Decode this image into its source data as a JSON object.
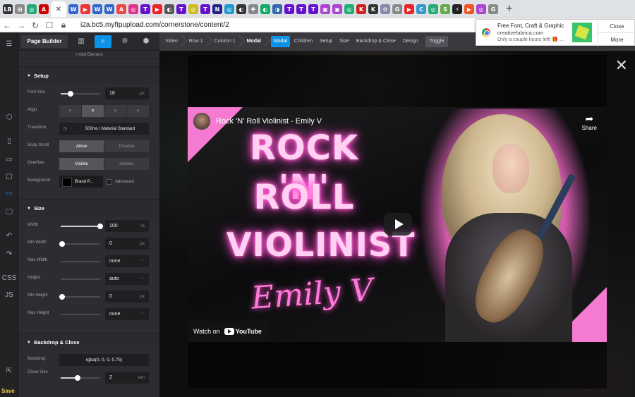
{
  "browser": {
    "url": "i2a.bc5.myftpupload.com/cornerstone/content/2",
    "tab_glyphs": [
      "LB",
      "⊞",
      "◎",
      "A",
      "W",
      "▶",
      "W",
      "W",
      "A",
      "◎",
      "T",
      "▶",
      "◐",
      "T",
      "◎",
      "T",
      "N",
      "◎",
      "◐",
      "✚",
      "◐",
      "◑",
      "T",
      "T",
      "T",
      "▣",
      "▣",
      "◎",
      "K",
      "K",
      "⚙",
      "G",
      "▶",
      "C",
      "◎",
      "S",
      "⚡",
      "▶",
      "◎",
      "G"
    ],
    "tab_colors": [
      "#333",
      "#888",
      "#2a7",
      "#c00",
      "#36c",
      "#e33",
      "#36c",
      "#36c",
      "#e44",
      "#d38",
      "#61c",
      "#e22",
      "#555",
      "#61c",
      "#cb2",
      "#61c",
      "#228",
      "#29c",
      "#333",
      "#888",
      "#1a6",
      "#36a",
      "#61c",
      "#61c",
      "#61c",
      "#a4c",
      "#a4c",
      "#2a7",
      "#c22",
      "#333",
      "#88a",
      "#888",
      "#e22",
      "#39c",
      "#2a7",
      "#6a4",
      "#222",
      "#e52",
      "#a4c",
      "#888"
    ],
    "close_tab_glyph": "✕",
    "new_tab": "+"
  },
  "notification": {
    "title": "Free Font, Craft & Graphic",
    "domain": "creativefabrica.com",
    "message": "Only a couple hours left! 🎁 ...",
    "close_label": "Close",
    "more_label": "More"
  },
  "panel": {
    "title": "Page Builder",
    "add_element": "+ Add Element",
    "sections": {
      "setup": "Setup",
      "size": "Size",
      "backdrop": "Backdrop & Close"
    },
    "setup": {
      "font_size_label": "Font Size",
      "font_size_value": "16",
      "font_size_unit": "px",
      "align_label": "Align",
      "transition_label": "Transition",
      "transition_value": "500ms / Material Standard",
      "body_scroll_label": "Body Scroll",
      "body_scroll_on": "Allow",
      "body_scroll_off": "Disable",
      "overflow_label": "Overflow",
      "overflow_on": "Visible",
      "overflow_off": "Hidden",
      "background_label": "Background",
      "background_value": "Brand P...",
      "advanced_label": "Advanced"
    },
    "size": {
      "width_label": "Width",
      "width_value": "100",
      "width_unit": "%",
      "min_width_label": "Min Width",
      "min_width_value": "0",
      "min_width_unit": "px",
      "max_width_label": "Max Width",
      "max_width_value": "none",
      "height_label": "Height",
      "height_value": "auto",
      "min_height_label": "Min Height",
      "min_height_value": "0",
      "min_height_unit": "px",
      "max_height_label": "Max Height",
      "max_height_value": "none"
    },
    "backdrop": {
      "backdrop_label": "Backdrop",
      "backdrop_value": "rgba(0, 0, 0, 0.75)",
      "close_size_label": "Close Size",
      "close_size_value": "2",
      "close_size_unit": "em"
    },
    "dots": "···"
  },
  "rail": {
    "css_label": "CSS",
    "js_label": "JS",
    "save_label": "Save"
  },
  "crumbs": [
    "Video",
    "Row 1",
    "Column 1",
    "Modal"
  ],
  "tabs": [
    "Modal",
    "Children",
    "Setup",
    "Size",
    "Backdrop & Close",
    "Design",
    "Toggle"
  ],
  "video": {
    "channel_title": "Rock 'N' Roll Violinist - Emily V",
    "share_label": "Share",
    "line1": "ROCK 'N'",
    "line2": "ROLL",
    "line3": "VIOLINIST",
    "signature": "Emily V",
    "watch_on": "Watch on",
    "youtube_label": "YouTube"
  },
  "colors": {
    "accent": "#0e92e8",
    "neon_pink": "#f57ad1",
    "save": "#f2c94c"
  }
}
